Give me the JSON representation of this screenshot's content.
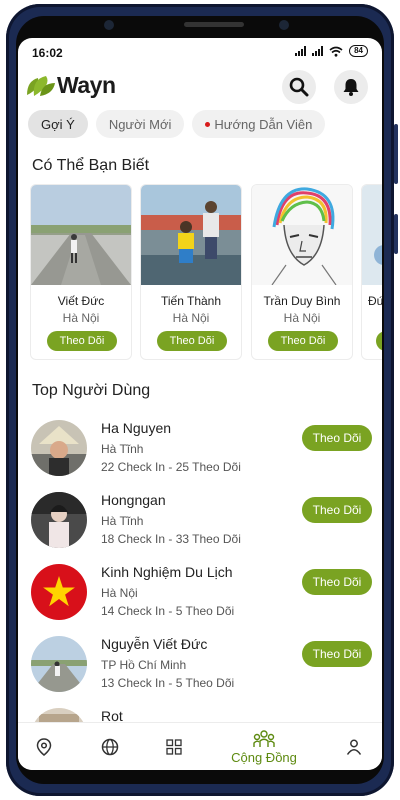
{
  "status_bar": {
    "time": "16:02",
    "battery": "84"
  },
  "app": {
    "logo_text": "Wayn"
  },
  "tabs": [
    {
      "label": "Gợi Ý",
      "active": true,
      "dot": false
    },
    {
      "label": "Người Mới",
      "active": false,
      "dot": false
    },
    {
      "label": "Hướng Dẫn Viên",
      "active": false,
      "dot": true
    }
  ],
  "suggestions": {
    "title": "Có Thể Bạn Biết",
    "items": [
      {
        "name": "Viết Đức",
        "location": "Hà Nội",
        "follow_label": "Theo Dõi"
      },
      {
        "name": "Tiến Thành",
        "location": "Hà Nội",
        "follow_label": "Theo Dõi"
      },
      {
        "name": "Trần Duy Bình",
        "location": "Hà Nội",
        "follow_label": "Theo Dõi"
      },
      {
        "name": "Đứ",
        "location": "",
        "follow_label": ""
      }
    ]
  },
  "top_users": {
    "title": "Top Người Dùng",
    "items": [
      {
        "name": "Ha Nguyen",
        "location": "Hà Tĩnh",
        "stats": "22 Check In - 25 Theo Dõi",
        "follow_label": "Theo Dõi"
      },
      {
        "name": "Hongngan",
        "location": "Hà Tĩnh",
        "stats": "18 Check In - 33 Theo Dõi",
        "follow_label": "Theo Dõi"
      },
      {
        "name": "Kinh Nghiệm Du Lịch",
        "location": "Hà Nội",
        "stats": "14 Check In - 5 Theo Dõi",
        "follow_label": "Theo Dõi"
      },
      {
        "name": "Nguyễn Viết Đức",
        "location": "TP Hồ Chí Minh",
        "stats": "13 Check In - 5 Theo Dõi",
        "follow_label": "Theo Dõi"
      },
      {
        "name": "Rọt",
        "location": "",
        "stats": "",
        "follow_label": ""
      }
    ]
  },
  "bottom_nav": {
    "items": [
      {
        "icon": "location-pin-icon",
        "label": ""
      },
      {
        "icon": "globe-icon",
        "label": ""
      },
      {
        "icon": "grid-icon",
        "label": ""
      },
      {
        "icon": "community-icon",
        "label": "Cộng Đồng",
        "active": true
      },
      {
        "icon": "person-icon",
        "label": ""
      }
    ]
  },
  "colors": {
    "accent": "#7aa322",
    "accent_dark": "#5d8a10",
    "notification_dot": "#d81b1b"
  }
}
